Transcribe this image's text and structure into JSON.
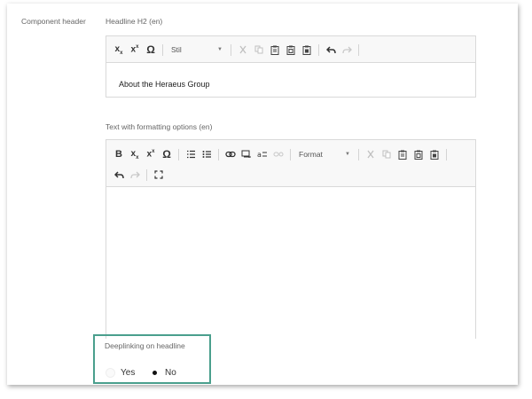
{
  "component_label": "Component header",
  "headline": {
    "label": "Headline H2 (en)",
    "style_combo": "Stil",
    "content": "About the Heraeus Group"
  },
  "rich_text": {
    "label": "Text with formatting options (en)",
    "format_combo": "Format"
  },
  "deeplinking": {
    "label": "Deeplinking on headline",
    "yes": "Yes",
    "no": "No",
    "selected": "No"
  },
  "colors": {
    "highlight_border": "#4a9f8d",
    "toolbar_bg": "#f8f8f8"
  },
  "icons": {
    "subscript": "xₓ",
    "superscript": "x²",
    "omega": "Ω",
    "bold": "B",
    "cut": "✕",
    "undo": "↶",
    "redo": "↷"
  }
}
